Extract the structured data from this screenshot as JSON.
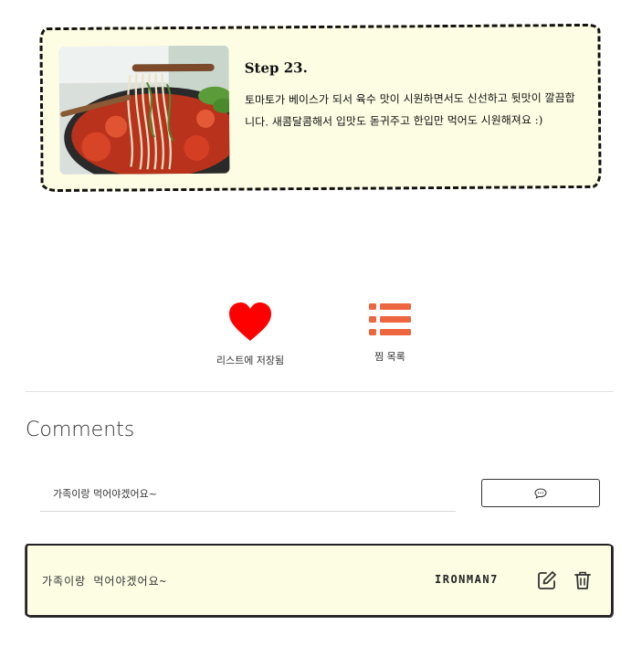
{
  "step": {
    "title": "Step 23.",
    "description": "토마토가 베이스가 되서 육수 맛이 시원하면서도 신선하고 뒷맛이 깔끔합니다. 새콤달콤해서 입맛도 돋귀주고 한입만 먹어도 시원해져요 :)",
    "image_alt": "tomato cold noodle dish"
  },
  "actions": {
    "favorite_label": "리스트에 저장됨",
    "list_label": "찜 목록",
    "heart_color": "#ff0000",
    "list_color": "#ee6640"
  },
  "comments": {
    "title": "Comments",
    "input_value": "가족이랑 먹어야겠어요~",
    "submit_icon": "chat-bubble-icon",
    "items": [
      {
        "text": "가족이랑 먹어야겠어요~",
        "user": "IRONMAN7"
      }
    ]
  }
}
